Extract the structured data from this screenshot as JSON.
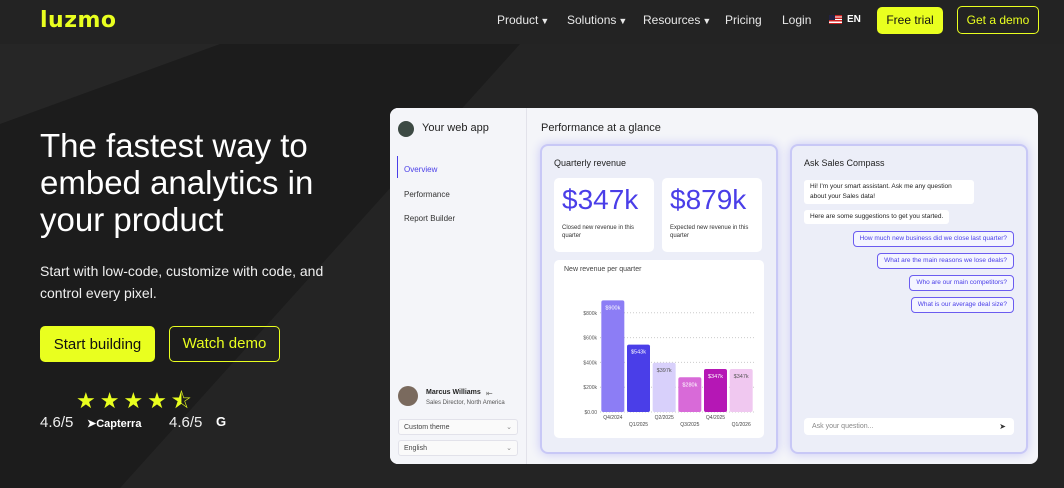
{
  "brand": {
    "logo": "luzmo",
    "accent": "#e9ff1f"
  },
  "nav": {
    "items": [
      {
        "label": "Product",
        "dropdown": true
      },
      {
        "label": "Solutions",
        "dropdown": true
      },
      {
        "label": "Resources",
        "dropdown": true
      },
      {
        "label": "Pricing",
        "dropdown": false
      },
      {
        "label": "Login",
        "dropdown": false
      }
    ],
    "language": "EN",
    "free_trial": "Free trial",
    "get_demo": "Get a demo"
  },
  "hero": {
    "title": "The fastest way to embed analytics in your product",
    "subtitle": "Start with low-code, customize with code, and control every pixel.",
    "start_building": "Start building",
    "watch_demo": "Watch demo",
    "stars": "★★★★⯪",
    "rating_capterra": "4.6/5",
    "capterra_label": "Capterra",
    "rating_g2": "4.6/5",
    "g2_label": "G"
  },
  "app": {
    "title": "Your web app",
    "sidebar": [
      "Overview",
      "Performance",
      "Report Builder"
    ],
    "user": {
      "name": "Marcus Williams",
      "role": "Sales Director, North America"
    },
    "theme_select": "Custom theme",
    "language_select": "English",
    "main_title": "Performance at a glance",
    "revenue_panel": {
      "title": "Quarterly revenue",
      "kpi1": {
        "value": "$347k",
        "label": "Closed new revenue in this quarter"
      },
      "kpi2": {
        "value": "$879k",
        "label": "Expected new revenue in this quarter"
      }
    },
    "compass": {
      "title": "Ask Sales Compass",
      "intro": "Hi! I'm your smart assistant. Ask me any question about your Sales data!",
      "intro2": "Here are some suggestions to get you started.",
      "suggestions": [
        "How much new business did we close last quarter?",
        "What are the main reasons we lose deals?",
        "Who are our main competitors?",
        "What is our average deal size?"
      ],
      "placeholder": "Ask your question..."
    }
  },
  "chart_data": {
    "type": "bar",
    "title": "New revenue per quarter",
    "categories": [
      "Q4/2024",
      "Q1/2025",
      "Q2/2025",
      "Q3/2025",
      "Q4/2025",
      "Q1/2026"
    ],
    "values": [
      900,
      543,
      397,
      280,
      347,
      347
    ],
    "data_labels": [
      "$900k",
      "$543k",
      "$397k",
      "$280k",
      "$347k",
      "$347k"
    ],
    "colors": [
      "#8c7df5",
      "#4a3ee8",
      "#d8d0fb",
      "#d86ad8",
      "#b517b5",
      "#f0c8f0"
    ],
    "label_colors": [
      "#ffffff",
      "#ffffff",
      "#555555",
      "#ffffff",
      "#ffffff",
      "#555555"
    ],
    "y_ticks": [
      "$0.00",
      "$200k",
      "$400k",
      "$600k",
      "$800k"
    ],
    "ylim": [
      0,
      1000
    ],
    "grid": true
  }
}
